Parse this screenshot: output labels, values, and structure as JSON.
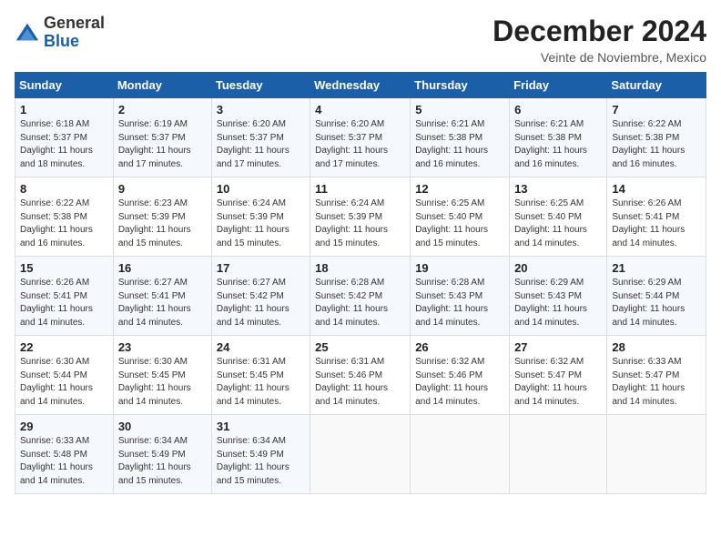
{
  "logo": {
    "general": "General",
    "blue": "Blue"
  },
  "header": {
    "month": "December 2024",
    "location": "Veinte de Noviembre, Mexico"
  },
  "days_of_week": [
    "Sunday",
    "Monday",
    "Tuesday",
    "Wednesday",
    "Thursday",
    "Friday",
    "Saturday"
  ],
  "weeks": [
    [
      {
        "day": "1",
        "sunrise": "6:18 AM",
        "sunset": "5:37 PM",
        "daylight": "11 hours and 18 minutes."
      },
      {
        "day": "2",
        "sunrise": "6:19 AM",
        "sunset": "5:37 PM",
        "daylight": "11 hours and 17 minutes."
      },
      {
        "day": "3",
        "sunrise": "6:20 AM",
        "sunset": "5:37 PM",
        "daylight": "11 hours and 17 minutes."
      },
      {
        "day": "4",
        "sunrise": "6:20 AM",
        "sunset": "5:37 PM",
        "daylight": "11 hours and 17 minutes."
      },
      {
        "day": "5",
        "sunrise": "6:21 AM",
        "sunset": "5:38 PM",
        "daylight": "11 hours and 16 minutes."
      },
      {
        "day": "6",
        "sunrise": "6:21 AM",
        "sunset": "5:38 PM",
        "daylight": "11 hours and 16 minutes."
      },
      {
        "day": "7",
        "sunrise": "6:22 AM",
        "sunset": "5:38 PM",
        "daylight": "11 hours and 16 minutes."
      }
    ],
    [
      {
        "day": "8",
        "sunrise": "6:22 AM",
        "sunset": "5:38 PM",
        "daylight": "11 hours and 16 minutes."
      },
      {
        "day": "9",
        "sunrise": "6:23 AM",
        "sunset": "5:39 PM",
        "daylight": "11 hours and 15 minutes."
      },
      {
        "day": "10",
        "sunrise": "6:24 AM",
        "sunset": "5:39 PM",
        "daylight": "11 hours and 15 minutes."
      },
      {
        "day": "11",
        "sunrise": "6:24 AM",
        "sunset": "5:39 PM",
        "daylight": "11 hours and 15 minutes."
      },
      {
        "day": "12",
        "sunrise": "6:25 AM",
        "sunset": "5:40 PM",
        "daylight": "11 hours and 15 minutes."
      },
      {
        "day": "13",
        "sunrise": "6:25 AM",
        "sunset": "5:40 PM",
        "daylight": "11 hours and 14 minutes."
      },
      {
        "day": "14",
        "sunrise": "6:26 AM",
        "sunset": "5:41 PM",
        "daylight": "11 hours and 14 minutes."
      }
    ],
    [
      {
        "day": "15",
        "sunrise": "6:26 AM",
        "sunset": "5:41 PM",
        "daylight": "11 hours and 14 minutes."
      },
      {
        "day": "16",
        "sunrise": "6:27 AM",
        "sunset": "5:41 PM",
        "daylight": "11 hours and 14 minutes."
      },
      {
        "day": "17",
        "sunrise": "6:27 AM",
        "sunset": "5:42 PM",
        "daylight": "11 hours and 14 minutes."
      },
      {
        "day": "18",
        "sunrise": "6:28 AM",
        "sunset": "5:42 PM",
        "daylight": "11 hours and 14 minutes."
      },
      {
        "day": "19",
        "sunrise": "6:28 AM",
        "sunset": "5:43 PM",
        "daylight": "11 hours and 14 minutes."
      },
      {
        "day": "20",
        "sunrise": "6:29 AM",
        "sunset": "5:43 PM",
        "daylight": "11 hours and 14 minutes."
      },
      {
        "day": "21",
        "sunrise": "6:29 AM",
        "sunset": "5:44 PM",
        "daylight": "11 hours and 14 minutes."
      }
    ],
    [
      {
        "day": "22",
        "sunrise": "6:30 AM",
        "sunset": "5:44 PM",
        "daylight": "11 hours and 14 minutes."
      },
      {
        "day": "23",
        "sunrise": "6:30 AM",
        "sunset": "5:45 PM",
        "daylight": "11 hours and 14 minutes."
      },
      {
        "day": "24",
        "sunrise": "6:31 AM",
        "sunset": "5:45 PM",
        "daylight": "11 hours and 14 minutes."
      },
      {
        "day": "25",
        "sunrise": "6:31 AM",
        "sunset": "5:46 PM",
        "daylight": "11 hours and 14 minutes."
      },
      {
        "day": "26",
        "sunrise": "6:32 AM",
        "sunset": "5:46 PM",
        "daylight": "11 hours and 14 minutes."
      },
      {
        "day": "27",
        "sunrise": "6:32 AM",
        "sunset": "5:47 PM",
        "daylight": "11 hours and 14 minutes."
      },
      {
        "day": "28",
        "sunrise": "6:33 AM",
        "sunset": "5:47 PM",
        "daylight": "11 hours and 14 minutes."
      }
    ],
    [
      {
        "day": "29",
        "sunrise": "6:33 AM",
        "sunset": "5:48 PM",
        "daylight": "11 hours and 14 minutes."
      },
      {
        "day": "30",
        "sunrise": "6:34 AM",
        "sunset": "5:49 PM",
        "daylight": "11 hours and 15 minutes."
      },
      {
        "day": "31",
        "sunrise": "6:34 AM",
        "sunset": "5:49 PM",
        "daylight": "11 hours and 15 minutes."
      },
      null,
      null,
      null,
      null
    ]
  ],
  "labels": {
    "sunrise": "Sunrise:",
    "sunset": "Sunset:",
    "daylight": "Daylight:"
  }
}
